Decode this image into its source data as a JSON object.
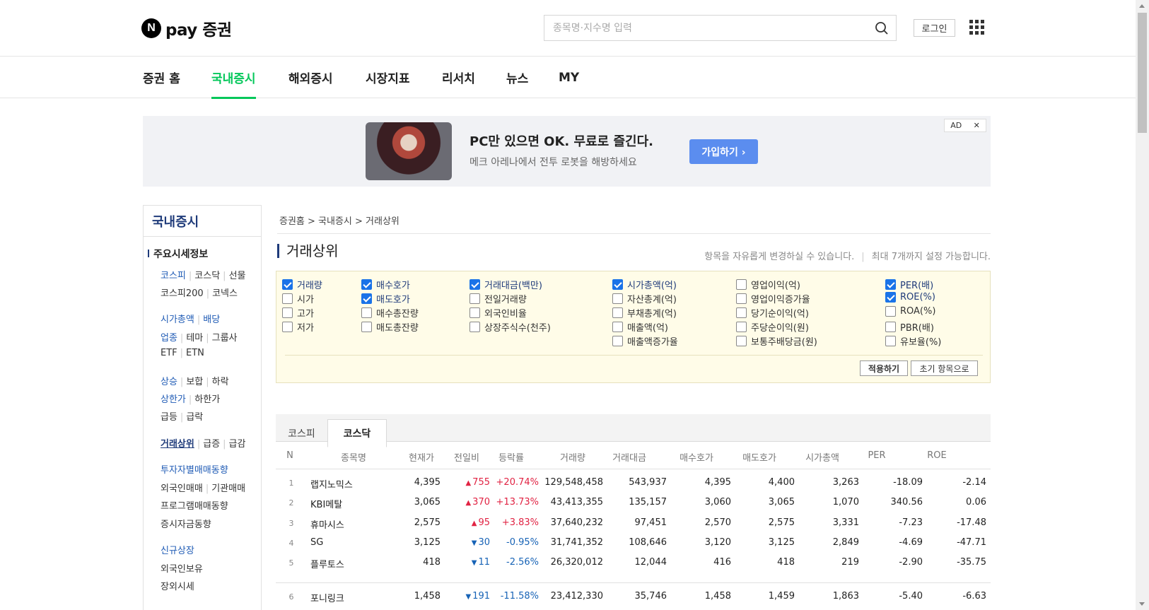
{
  "header": {
    "logo_mark": "N",
    "logo_text": "pay 증권",
    "search_placeholder": "종목명·지수명 입력",
    "login_label": "로그인"
  },
  "gnb": [
    "증권 홈",
    "국내증시",
    "해외증시",
    "시장지표",
    "리서치",
    "뉴스",
    "MY"
  ],
  "ad": {
    "title": "PC만 있으면 OK. 무료로 즐긴다.",
    "subtitle": "메크 아레나에서 전투 로봇을 해방하세요",
    "button": "가입하기 ›",
    "badge": "AD",
    "close": "✕"
  },
  "lnb": {
    "title": "국내증시",
    "section": "주요시세정보",
    "rows": [
      [
        "코스피",
        "코스닥",
        "선물"
      ],
      [
        "코스피200",
        "코넥스"
      ],
      [
        "시가총액",
        "배당"
      ],
      [
        "업종",
        "테마",
        "그룹사"
      ],
      [
        "ETF",
        "ETN"
      ],
      [
        "상승",
        "보합",
        "하락"
      ],
      [
        "상한가",
        "하한가"
      ],
      [
        "급등",
        "급락"
      ],
      [
        "거래상위",
        "급증",
        "급감"
      ],
      [
        "투자자별매매동향"
      ],
      [
        "외국인매매",
        "기관매매"
      ],
      [
        "프로그램매매동향"
      ],
      [
        "증시자금동향"
      ],
      [
        "신규상장"
      ],
      [
        "외국인보유"
      ],
      [
        "장외시세"
      ]
    ]
  },
  "breadcrumb": "증권홈 > 국내증시 > 거래상위",
  "page_title": "거래상위",
  "note": {
    "left": "항목을 자유롭게 변경하실 수 있습니다.",
    "right": "최대 7개까지 설정 가능합니다."
  },
  "options": [
    [
      {
        "label": "거래량",
        "checked": true
      },
      {
        "label": "시가",
        "checked": false
      },
      {
        "label": "고가",
        "checked": false
      },
      {
        "label": "저가",
        "checked": false
      }
    ],
    [
      {
        "label": "매수호가",
        "checked": true
      },
      {
        "label": "매도호가",
        "checked": true
      },
      {
        "label": "매수총잔량",
        "checked": false
      },
      {
        "label": "매도총잔량",
        "checked": false
      }
    ],
    [
      {
        "label": "거래대금(백만)",
        "checked": true
      },
      {
        "label": "전일거래량",
        "checked": false
      },
      {
        "label": "외국인비율",
        "checked": false
      },
      {
        "label": "상장주식수(천주)",
        "checked": false
      }
    ],
    [
      {
        "label": "시가총액(억)",
        "checked": true
      },
      {
        "label": "자산총계(억)",
        "checked": false
      },
      {
        "label": "부채총계(억)",
        "checked": false
      },
      {
        "label": "매출액(억)",
        "checked": false
      },
      {
        "label": "매출액증가율",
        "checked": false
      }
    ],
    [
      {
        "label": "영업이익(억)",
        "checked": false
      },
      {
        "label": "영업이익증가율",
        "checked": false
      },
      {
        "label": "당기순이익(억)",
        "checked": false
      },
      {
        "label": "주당순이익(원)",
        "checked": false
      },
      {
        "label": "보통주배당금(원)",
        "checked": false
      }
    ],
    [
      {
        "label": "PER(배)",
        "checked": true
      },
      {
        "label": "ROE(%)",
        "checked": true
      },
      {
        "label": "ROA(%)",
        "checked": false
      },
      {
        "label": "PBR(배)",
        "checked": false
      },
      {
        "label": "유보율(%)",
        "checked": false
      }
    ]
  ],
  "buttons": {
    "apply": "적용하기",
    "reset": "초기 항목으로"
  },
  "tabs": [
    "코스피",
    "코스닥"
  ],
  "table": {
    "headers": [
      "N",
      "종목명",
      "현재가",
      "전일비",
      "등락률",
      "거래량",
      "거래대금",
      "매수호가",
      "매도호가",
      "시가총액",
      "PER",
      "ROE"
    ],
    "rows": [
      {
        "n": "1",
        "name": "랩지노믹스",
        "price": "4,395",
        "dir": "up",
        "diff": "755",
        "rate": "+20.74%",
        "volume": "129,548,458",
        "amount": "543,937",
        "bid": "4,395",
        "ask": "4,400",
        "cap": "3,263",
        "per": "-18.09",
        "roe": "-2.14"
      },
      {
        "n": "2",
        "name": "KBI메탈",
        "price": "3,065",
        "dir": "up",
        "diff": "370",
        "rate": "+13.73%",
        "volume": "43,413,355",
        "amount": "135,157",
        "bid": "3,060",
        "ask": "3,065",
        "cap": "1,070",
        "per": "340.56",
        "roe": "0.06"
      },
      {
        "n": "3",
        "name": "휴마시스",
        "price": "2,575",
        "dir": "up",
        "diff": "95",
        "rate": "+3.83%",
        "volume": "37,640,232",
        "amount": "97,451",
        "bid": "2,570",
        "ask": "2,575",
        "cap": "3,331",
        "per": "-7.23",
        "roe": "-17.48"
      },
      {
        "n": "4",
        "name": "SG",
        "price": "3,125",
        "dir": "down",
        "diff": "30",
        "rate": "-0.95%",
        "volume": "31,741,352",
        "amount": "108,646",
        "bid": "3,120",
        "ask": "3,125",
        "cap": "2,849",
        "per": "-4.69",
        "roe": "-47.71"
      },
      {
        "n": "5",
        "name": "플루토스",
        "price": "418",
        "dir": "down",
        "diff": "11",
        "rate": "-2.56%",
        "volume": "26,320,012",
        "amount": "12,044",
        "bid": "416",
        "ask": "418",
        "cap": "219",
        "per": "-2.90",
        "roe": "-35.75"
      },
      {
        "n": "6",
        "name": "포니링크",
        "price": "1,458",
        "dir": "down",
        "diff": "191",
        "rate": "-11.58%",
        "volume": "23,412,330",
        "amount": "35,746",
        "bid": "1,458",
        "ask": "1,459",
        "cap": "1,863",
        "per": "-5.40",
        "roe": "-6.63"
      }
    ]
  },
  "colors": {
    "accent": "#03c75a",
    "up": "#e12343",
    "down": "#1763b6",
    "navy": "#1f3b7a"
  }
}
